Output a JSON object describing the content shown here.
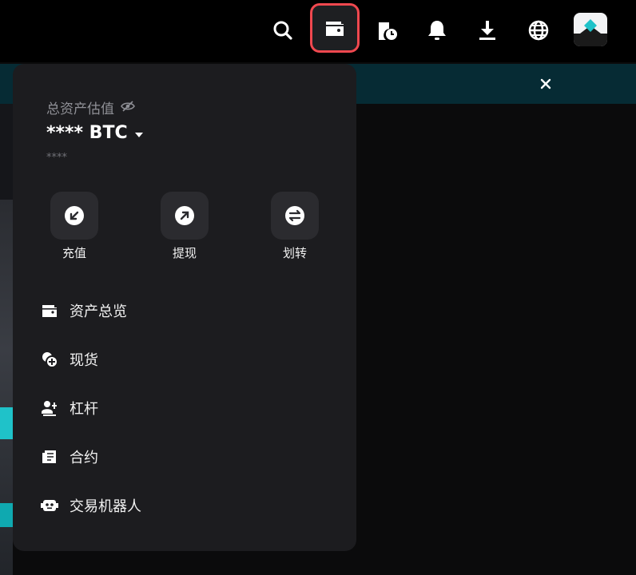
{
  "navbar": {
    "icons": [
      "search-icon",
      "wallet-icon",
      "order-history-icon",
      "bell-icon",
      "download-icon",
      "globe-icon"
    ]
  },
  "banner": {
    "close_icon": "close-icon"
  },
  "assets_panel": {
    "estimated_label": "总资产估值",
    "balance_masked": "**** BTC",
    "sub_balance_masked": "****",
    "actions": [
      {
        "label": "充值",
        "icon": "deposit-icon"
      },
      {
        "label": "提现",
        "icon": "withdraw-icon"
      },
      {
        "label": "划转",
        "icon": "transfer-icon"
      }
    ],
    "menu": [
      {
        "label": "资产总览",
        "icon": "wallet-icon"
      },
      {
        "label": "现货",
        "icon": "coins-icon"
      },
      {
        "label": "杠杆",
        "icon": "margin-icon"
      },
      {
        "label": "合约",
        "icon": "futures-icon"
      },
      {
        "label": "交易机器人",
        "icon": "bot-icon"
      }
    ]
  },
  "colors": {
    "highlight_border": "#f0484f",
    "panel_bg": "#1c1c1f",
    "banner_bg": "#062b34",
    "logo_accent": "#1fc2c9"
  }
}
